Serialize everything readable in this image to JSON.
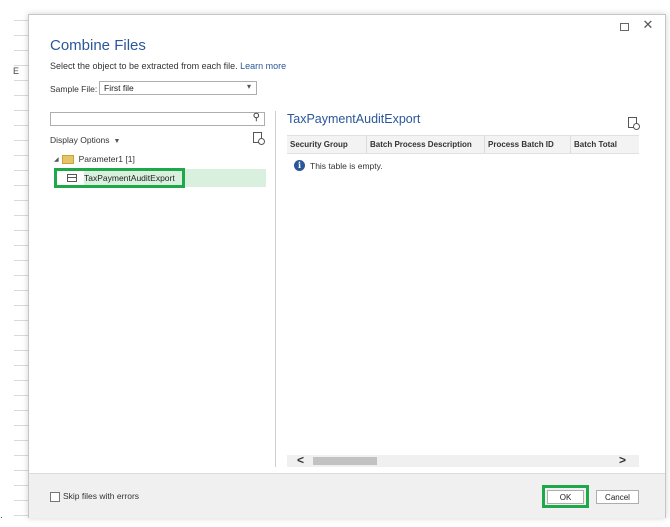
{
  "excel": {
    "column_letter": "E",
    "bottom_mark": "."
  },
  "dialog": {
    "title": "Combine Files",
    "subtitle": "Select the object to be extracted from each file.",
    "learn_more": "Learn more",
    "sample_file_label": "Sample File:",
    "sample_file_value": "First file",
    "search_placeholder": "",
    "display_options": "Display Options",
    "tree": {
      "parent_label": "Parameter1 [1]",
      "child_label": "TaxPaymentAuditExport"
    },
    "preview": {
      "title": "TaxPaymentAuditExport",
      "columns": [
        "Security Group",
        "Batch Process Description",
        "Process Batch ID",
        "Batch Total"
      ],
      "empty_message": "This table is empty."
    },
    "footer": {
      "skip_label": "Skip files with errors",
      "skip_checked": false,
      "ok_label": "OK",
      "cancel_label": "Cancel"
    }
  },
  "colors": {
    "accent": "#2b579a",
    "highlight": "#1fa84a",
    "selection": "#d8f0dd"
  },
  "icons": {
    "search": "search-icon",
    "new_table_left": "new-table-icon",
    "new_table_right": "new-table-icon",
    "info": "info-icon",
    "folder": "folder-icon",
    "table": "table-icon"
  }
}
